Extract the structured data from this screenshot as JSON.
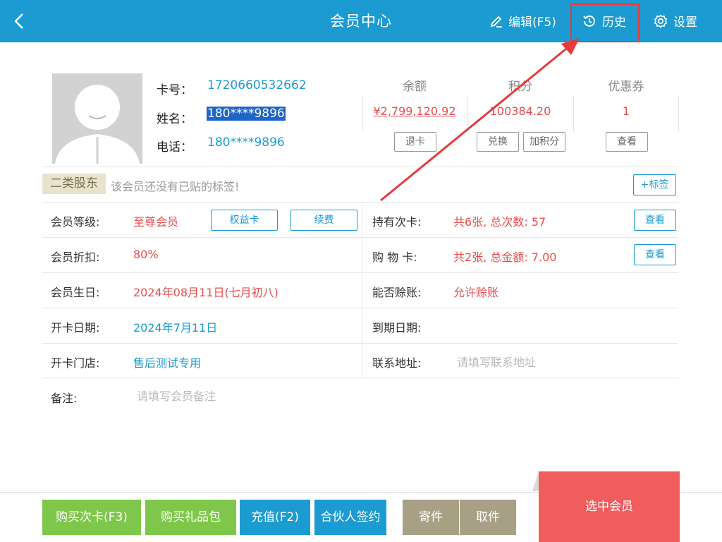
{
  "header": {
    "title": "会员中心",
    "edit_label": "编辑(F5)",
    "history_label": "历史",
    "settings_label": "设置"
  },
  "member": {
    "card_no_label": "卡号：",
    "card_no": "1720660532662",
    "name_label": "姓名：",
    "name": "180****9896",
    "phone_label": "电话：",
    "phone": "180****9896"
  },
  "stats": {
    "balance_label": "余额",
    "balance": "¥2,799,120.92",
    "points_label": "积分",
    "points": "100384.20",
    "coupon_label": "优惠券",
    "coupon": "1",
    "refund_card_btn": "退卡",
    "exchange_btn": "兑换",
    "add_points_btn": "加积分",
    "view_coupon_btn": "查看"
  },
  "tags": {
    "badge": "二类股东",
    "tip": "该会员还没有已贴的标签!",
    "add_btn": "+标签"
  },
  "details": {
    "level_label": "会员等级:",
    "level": "至尊会员",
    "benefit_card_btn": "权益卡",
    "renew_btn": "续费",
    "times_card_label": "持有次卡:",
    "times_card": "共6张, 总次数: 57",
    "times_card_view_btn": "查看",
    "discount_label": "会员折扣:",
    "discount": "80%",
    "shopping_card_label": "购 物 卡:",
    "shopping_card": "共2张, 总金额: 7.00",
    "shopping_card_view_btn": "查看",
    "birthday_label": "会员生日:",
    "birthday": "2024年08月11日(七月初八)",
    "credit_label": "能否赊账:",
    "credit": "允许赊账",
    "open_date_label": "开卡日期:",
    "open_date": "2024年7月11日",
    "expire_label": "到期日期:",
    "expire": "",
    "open_store_label": "开卡门店:",
    "open_store": "售后测试专用",
    "address_label": "联系地址:",
    "address_placeholder": "请填写联系地址",
    "remark_label": "备注:",
    "remark_placeholder": "请填写会员备注"
  },
  "footer": {
    "buy_times_card": "购买次卡(F3)",
    "buy_gift_pack": "购买礼品包",
    "recharge": "充值(F2)",
    "partner_sign": "合伙人签约",
    "deposit": "寄件",
    "pickup": "取件",
    "select_member": "选中会员"
  },
  "colors": {
    "header_bg": "#1b9bd1",
    "accent_blue": "#1b9bd1",
    "accent_red": "#e84c4c",
    "green_btn": "#7ec74a",
    "khaki_btn": "#a8a085",
    "select_member_bg": "#f15c5c",
    "annotation_red": "#e8393b"
  }
}
